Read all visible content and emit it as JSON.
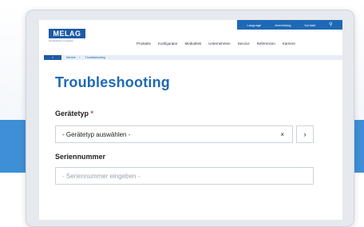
{
  "logo": {
    "brand": "MELAG",
    "tagline": "competence in hygiene"
  },
  "utility_links": [
    "Language",
    "Anmeldung",
    "Kontakt"
  ],
  "nav": [
    "Produkte",
    "Konfigurator",
    "Mediathek",
    "Unternehmen",
    "Service",
    "Referenzen",
    "Karriere"
  ],
  "breadcrumb": {
    "items": [
      "Service",
      "Troubleshooting"
    ],
    "separator": ">"
  },
  "page": {
    "title": "Troubleshooting"
  },
  "form": {
    "device_type_label": "Gerätetyp",
    "required_mark": "*",
    "device_type_value": "- Gerätetyp auswählen -",
    "clear_symbol": "×",
    "next_symbol": "›",
    "serial_label": "Seriennummer",
    "serial_placeholder": "- Seriennummer eingeben -"
  },
  "colors": {
    "brand_blue": "#1e69b6",
    "stripe_blue": "#3e8fd6",
    "required_red": "#d24545"
  },
  "icons": {
    "search": "search-icon",
    "home": "home-icon",
    "clear": "close-icon",
    "next": "chevron-right-icon"
  }
}
